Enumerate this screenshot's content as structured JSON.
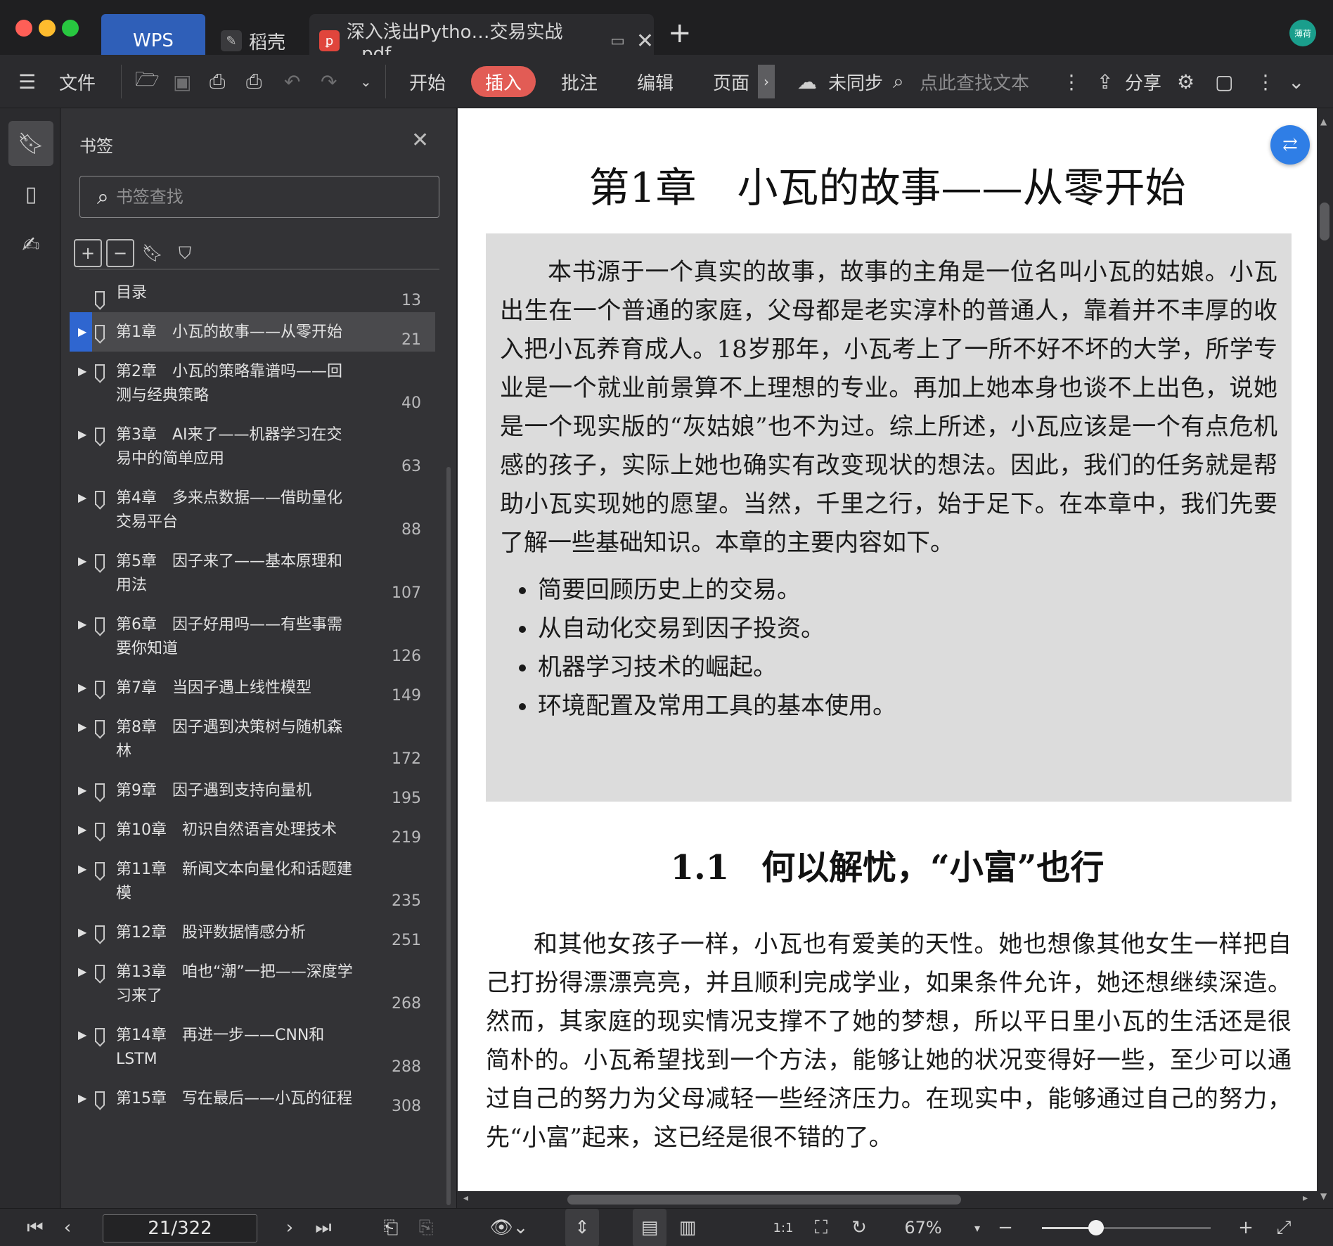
{
  "titlebar": {
    "tabs": [
      {
        "label": "WPS"
      },
      {
        "label": "稻壳"
      },
      {
        "label": "深入浅出Pytho…交易实战_.pdf"
      }
    ],
    "avatar_text": "薄荷"
  },
  "toolbar": {
    "file_label": "文件",
    "menus": [
      "开始",
      "插入",
      "批注",
      "编辑",
      "页面"
    ],
    "active_menu": "插入",
    "sync_label": "未同步",
    "search_hint": "点此查找文本",
    "share_label": "分享"
  },
  "bookmark_panel": {
    "title": "书签",
    "search_placeholder": "书签查找",
    "items": [
      {
        "title": "目录",
        "page": "13",
        "expandable": false
      },
      {
        "title": "第1章　小瓦的故事——从零开始",
        "page": "21",
        "expandable": true,
        "active": true
      },
      {
        "title": "第2章　小瓦的策略靠谱吗——回测与经典策略",
        "page": "40",
        "expandable": true
      },
      {
        "title": "第3章　AI来了——机器学习在交易中的简单应用",
        "page": "63",
        "expandable": true
      },
      {
        "title": "第4章　多来点数据——借助量化交易平台",
        "page": "88",
        "expandable": true
      },
      {
        "title": "第5章　因子来了——基本原理和用法",
        "page": "107",
        "expandable": true
      },
      {
        "title": "第6章　因子好用吗——有些事需要你知道",
        "page": "126",
        "expandable": true
      },
      {
        "title": "第7章　当因子遇上线性模型",
        "page": "149",
        "expandable": true
      },
      {
        "title": "第8章　因子遇到决策树与随机森林",
        "page": "172",
        "expandable": true
      },
      {
        "title": "第9章　因子遇到支持向量机",
        "page": "195",
        "expandable": true
      },
      {
        "title": "第10章　初识自然语言处理技术",
        "page": "219",
        "expandable": true
      },
      {
        "title": "第11章　新闻文本向量化和话题建模",
        "page": "235",
        "expandable": true
      },
      {
        "title": "第12章　股评数据情感分析",
        "page": "251",
        "expandable": true
      },
      {
        "title": "第13章　咱也“潮”一把——深度学习来了",
        "page": "268",
        "expandable": true
      },
      {
        "title": "第14章　再进一步——CNN和LSTM",
        "page": "288",
        "expandable": true
      },
      {
        "title": "第15章　写在最后——小瓦的征程",
        "page": "308",
        "expandable": true
      }
    ]
  },
  "document": {
    "chapter_title": "第1章　小瓦的故事——从零开始",
    "intro_paragraph": "本书源于一个真实的故事，故事的主角是一位名叫小瓦的姑娘。小瓦出生在一个普通的家庭，父母都是老实淳朴的普通人，靠着并不丰厚的收入把小瓦养育成人。18岁那年，小瓦考上了一所不好不坏的大学，所学专业是一个就业前景算不上理想的专业。再加上她本身也谈不上出色，说她是一个现实版的“灰姑娘”也不为过。综上所述，小瓦应该是一个有点危机感的孩子，实际上她也确实有改变现状的想法。因此，我们的任务就是帮助小瓦实现她的愿望。当然，千里之行，始于足下。在本章中，我们先要了解一些基础知识。本章的主要内容如下。",
    "intro_list": [
      "简要回顾历史上的交易。",
      "从自动化交易到因子投资。",
      "机器学习技术的崛起。",
      "环境配置及常用工具的基本使用。"
    ],
    "section_number": "1.1",
    "section_title": "何以解忧，“小富”也行",
    "body_paragraph": "和其他女孩子一样，小瓦也有爱美的天性。她也想像其他女生一样把自己打扮得漂漂亮亮，并且顺利完成学业，如果条件允许，她还想继续深造。然而，其家庭的现实情况支撑不了她的梦想，所以平日里小瓦的生活还是很简朴的。小瓦希望找到一个方法，能够让她的状况变得好一些，至少可以通过自己的努力为父母减轻一些经济压力。在现实中，能够通过自己的努力，先“小富”起来，这已经是很不错的了。"
  },
  "statusbar": {
    "page_indicator": "21/322",
    "zoom_label": "67%",
    "zoom_level": 0.28
  },
  "colors": {
    "accent_blue": "#2f66d0",
    "insert_red": "#e25c55",
    "wps_tab": "#2f5fb8",
    "pdf_icon": "#e0453c",
    "avatar": "#1a9e8c"
  }
}
